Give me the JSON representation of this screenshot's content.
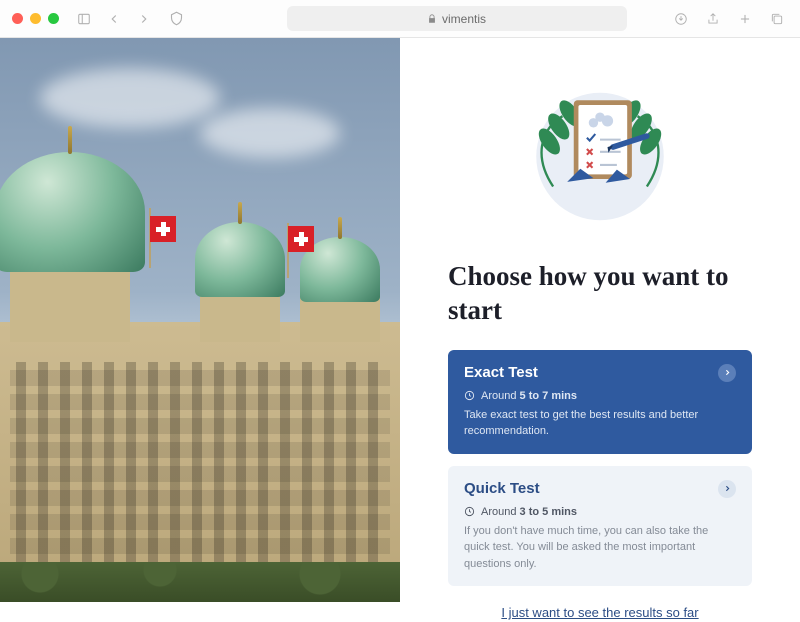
{
  "browser": {
    "address": "vimentis"
  },
  "panel": {
    "heading": "Choose how you want to start",
    "skip_link": "I just want to see the results so far"
  },
  "cards": {
    "exact": {
      "title": "Exact Test",
      "meta_prefix": "Around ",
      "meta_bold": "5 to 7 mins",
      "desc": "Take exact test to get the best results and better recommendation."
    },
    "quick": {
      "title": "Quick Test",
      "meta_prefix": "Around ",
      "meta_bold": "3 to 5 mins",
      "desc": "If you don't have much time, you can also take the quick test. You will be asked the most important questions only."
    }
  }
}
